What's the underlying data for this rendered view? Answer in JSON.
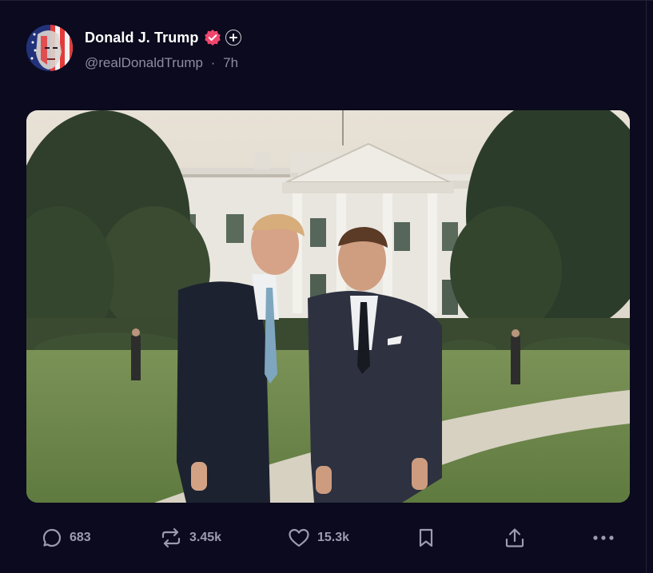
{
  "post": {
    "author": {
      "display_name": "Donald J. Trump",
      "handle": "@realDonaldTrump",
      "time": "7h",
      "separator": "·",
      "avatar_icon": "flag-face-avatar",
      "verified_color": "#f0466d"
    },
    "image_alt": "Photo of two men in suits standing on the White House lawn",
    "actions": {
      "replies": "683",
      "reposts": "3.45k",
      "likes": "15.3k"
    }
  },
  "colors": {
    "background": "#0b0a1e",
    "muted_text": "#8d8ca3",
    "icon": "#9c9bb0",
    "verified": "#f0466d"
  }
}
